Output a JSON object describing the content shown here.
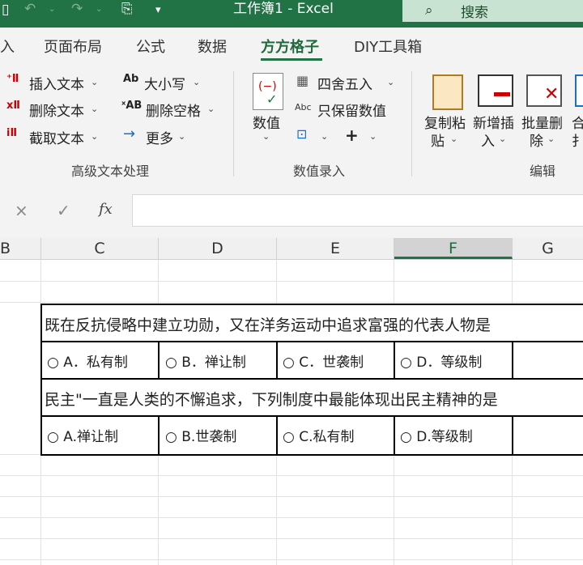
{
  "window": {
    "title": "工作簿1  -  Excel",
    "search_placeholder": "搜索"
  },
  "tabs": [
    "入",
    "页面布局",
    "公式",
    "数据",
    "方方格子",
    "DIY工具箱"
  ],
  "active_tab_index": 4,
  "ribbon": {
    "text_group": {
      "label": "高级文本处理",
      "insert_text": "插入文本",
      "delete_text": "删除文本",
      "extract_text": "截取文本",
      "case": "大小写",
      "delete_spaces": "删除空格",
      "more": "更多"
    },
    "number_group": {
      "label": "数值录入",
      "value": "数值",
      "round": "四舍五入",
      "keep_values": "只保留数值",
      "plus": "+"
    },
    "edit_group": {
      "label": "编辑",
      "copy_paste_1": "复制粘",
      "copy_paste_2": "贴",
      "add_insert_1": "新增插",
      "add_insert_2": "入",
      "batch_delete_1": "批量删",
      "batch_delete_2": "除",
      "merge_1": "合",
      "merge_2": "扌"
    }
  },
  "formula_bar": {
    "cancel": "×",
    "enter": "✓",
    "fx": "fx",
    "content": ""
  },
  "columns": [
    "B",
    "C",
    "D",
    "E",
    "F",
    "G"
  ],
  "selected_column": "F",
  "questions": [
    {
      "text": "既在反抗侵略中建立功勋，又在洋务运动中追求富强的代表人物是",
      "options": [
        "A．私有制",
        "B．禅让制",
        "C．世袭制",
        "D．等级制"
      ]
    },
    {
      "text": "民主\"一直是人类的不懈追求，下列制度中最能体现出民主精神的是",
      "options": [
        "A.禅让制",
        "B.世袭制",
        "C.私有制",
        "D.等级制"
      ]
    }
  ],
  "icons": {
    "radio": "○",
    "undo": "↶",
    "redo": "↷"
  }
}
